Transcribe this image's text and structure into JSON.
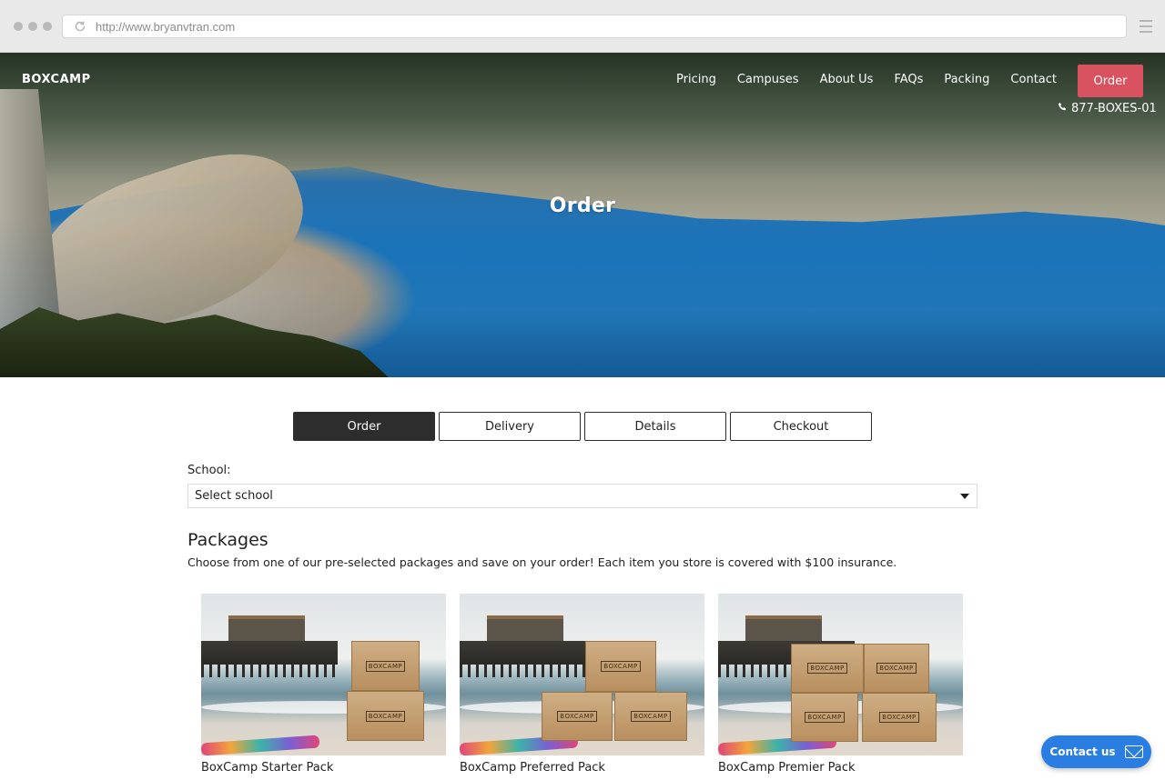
{
  "browser": {
    "url": "http://www.bryanvtran.com"
  },
  "header": {
    "brand": "BOXCAMP",
    "nav": [
      "Pricing",
      "Campuses",
      "About Us",
      "FAQs",
      "Packing",
      "Contact"
    ],
    "order_button": "Order",
    "phone": "877-BOXES-01"
  },
  "hero": {
    "title": "Order"
  },
  "steps": [
    {
      "label": "Order",
      "active": true
    },
    {
      "label": "Delivery",
      "active": false
    },
    {
      "label": "Details",
      "active": false
    },
    {
      "label": "Checkout",
      "active": false
    }
  ],
  "form": {
    "school_label": "School:",
    "school_value": "Select school"
  },
  "packages": {
    "title": "Packages",
    "description": "Choose from one of our pre-selected packages and save on your order! Each item you store is covered with $100 insurance.",
    "items": [
      {
        "name": "BoxCamp Starter Pack",
        "box_label": "BOXCAMP"
      },
      {
        "name": "BoxCamp Preferred Pack",
        "box_label": "BOXCAMP"
      },
      {
        "name": "BoxCamp Premier Pack",
        "box_label": "BOXCAMP"
      }
    ]
  },
  "contact_widget": {
    "label": "Contact us"
  },
  "colors": {
    "accent_red": "#d9525f",
    "contact_blue": "#2b7ee1",
    "active_step": "#2d2d2d"
  },
  "icons": {
    "reload": "reload-icon",
    "menu": "hamburger-menu-icon",
    "phone": "phone-icon",
    "dropdown": "chevron-down-icon",
    "mail": "mail-icon"
  }
}
